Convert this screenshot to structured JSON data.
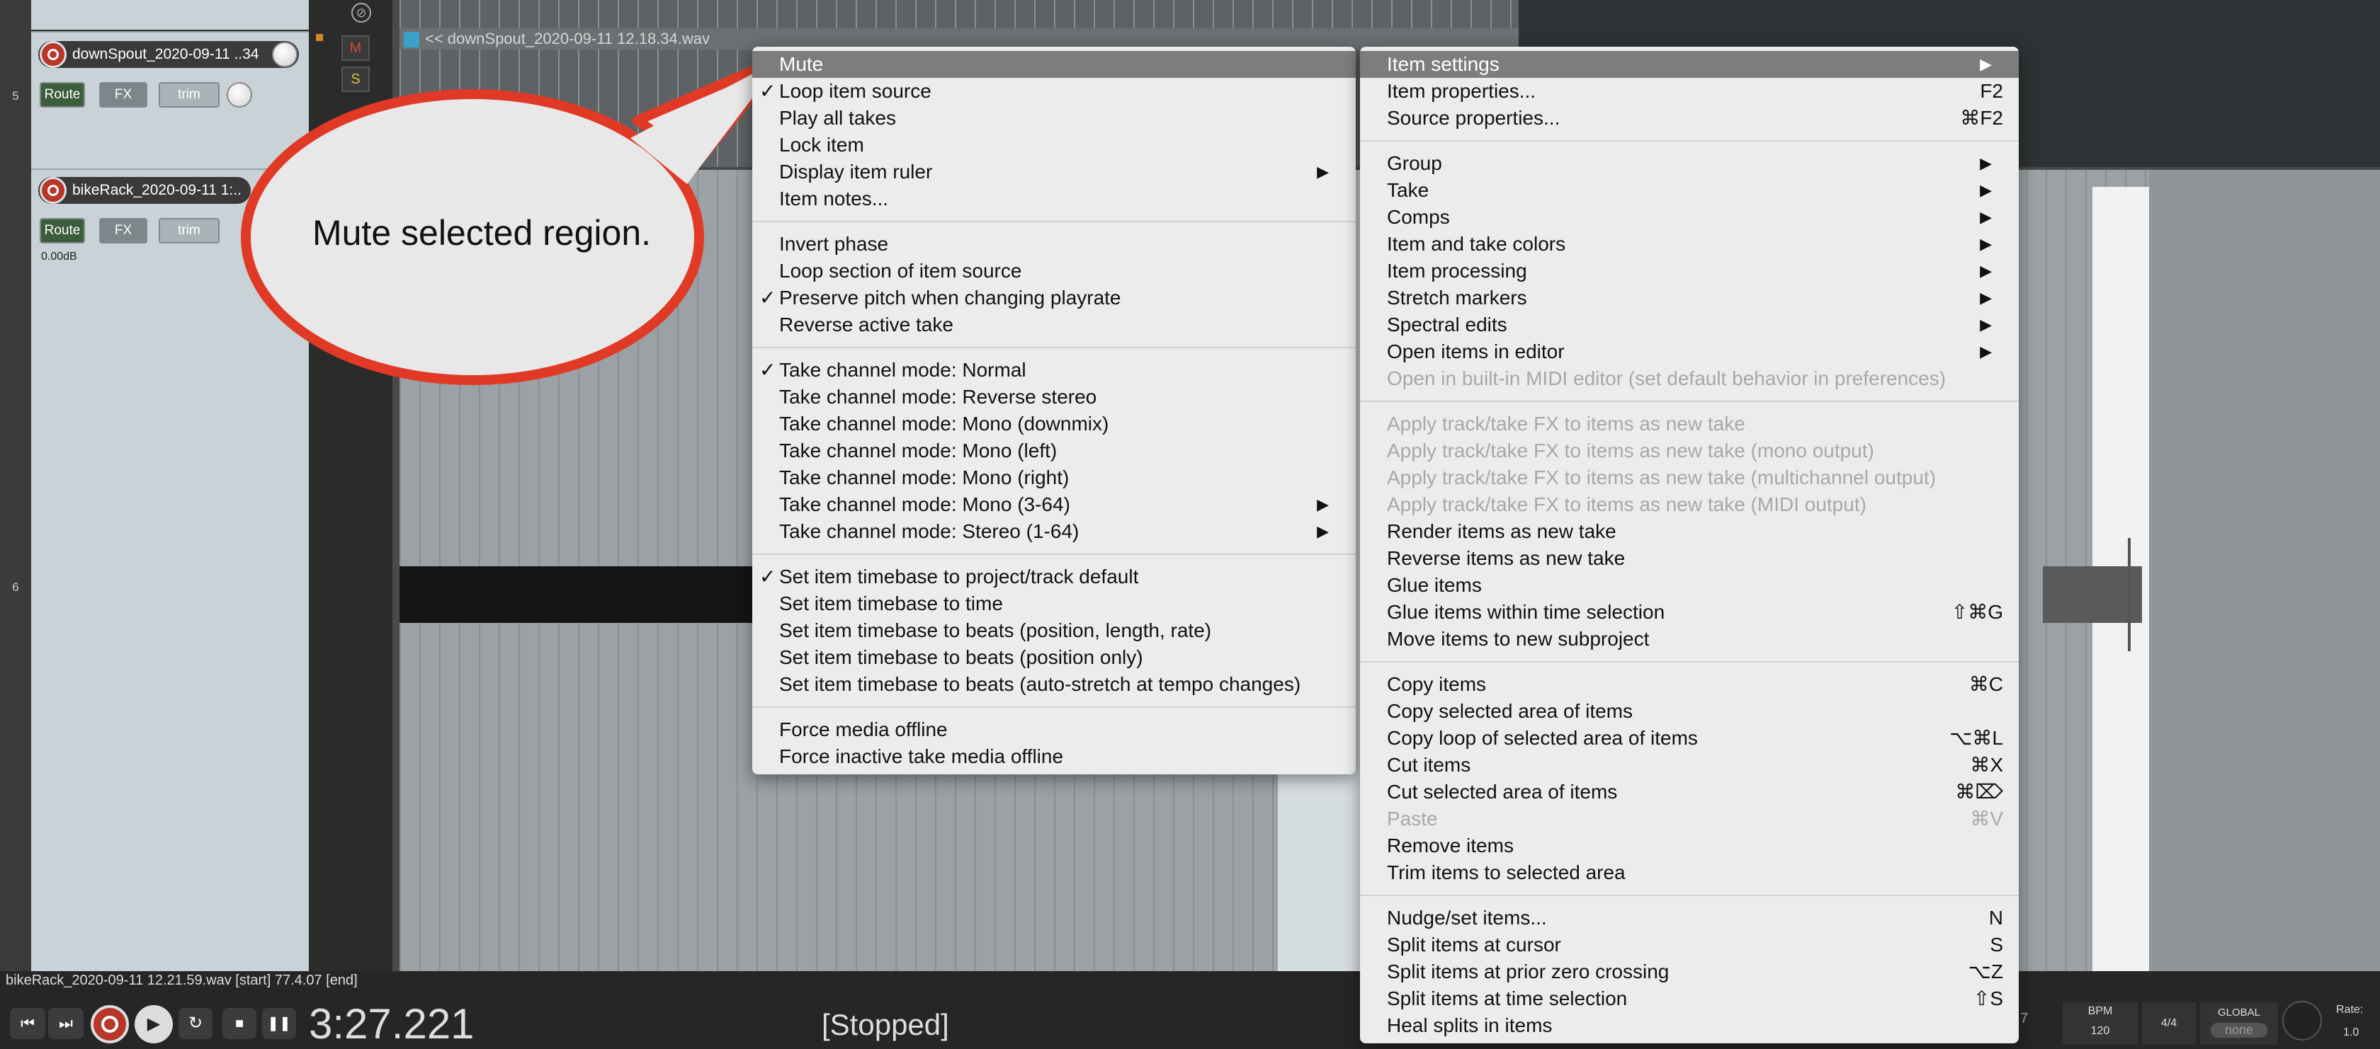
{
  "tracks": [
    {
      "number": "5",
      "name": "downSpout_2020-09-11 ..34"
    },
    {
      "number": "6",
      "name": "bikeRack_2020-09-11 1:..",
      "volume": "0.00dB"
    }
  ],
  "track_buttons": {
    "route": "Route",
    "fx": "FX",
    "trim": "trim",
    "mute": "M",
    "solo": "S"
  },
  "item_label": "<< downSpout_2020-09-11 12.18.34.wav",
  "status_text": "bikeRack_2020-09-11 12.21.59.wav [start] 77.4.07 [end]",
  "transport": {
    "time": "3:27.221",
    "state": "[Stopped]",
    "bpm_label": "BPM",
    "bpm": "120",
    "timesig": "4/4",
    "global_label": "GLOBAL",
    "global_value": "none",
    "rate_label": "Rate:",
    "rate": "1.0",
    "partial_digit": "7"
  },
  "callout": "Mute selected region.",
  "menu_left": [
    {
      "type": "item",
      "label": "Mute",
      "highlighted": true
    },
    {
      "type": "item",
      "label": "Loop item source",
      "checked": true
    },
    {
      "type": "item",
      "label": "Play all takes"
    },
    {
      "type": "item",
      "label": "Lock item"
    },
    {
      "type": "item",
      "label": "Display item ruler",
      "submenu": true
    },
    {
      "type": "item",
      "label": "Item notes..."
    },
    {
      "type": "sep"
    },
    {
      "type": "item",
      "label": "Invert phase"
    },
    {
      "type": "item",
      "label": "Loop section of item source"
    },
    {
      "type": "item",
      "label": "Preserve pitch when changing playrate",
      "checked": true
    },
    {
      "type": "item",
      "label": "Reverse active take"
    },
    {
      "type": "sep"
    },
    {
      "type": "item",
      "label": "Take channel mode: Normal",
      "checked": true
    },
    {
      "type": "item",
      "label": "Take channel mode: Reverse stereo"
    },
    {
      "type": "item",
      "label": "Take channel mode: Mono (downmix)"
    },
    {
      "type": "item",
      "label": "Take channel mode: Mono (left)"
    },
    {
      "type": "item",
      "label": "Take channel mode: Mono (right)"
    },
    {
      "type": "item",
      "label": "Take channel mode: Mono (3-64)",
      "submenu": true
    },
    {
      "type": "item",
      "label": "Take channel mode: Stereo (1-64)",
      "submenu": true
    },
    {
      "type": "sep"
    },
    {
      "type": "item",
      "label": "Set item timebase to project/track default",
      "checked": true
    },
    {
      "type": "item",
      "label": "Set item timebase to time"
    },
    {
      "type": "item",
      "label": "Set item timebase to beats (position, length, rate)"
    },
    {
      "type": "item",
      "label": "Set item timebase to beats (position only)"
    },
    {
      "type": "item",
      "label": "Set item timebase to beats (auto-stretch at tempo changes)"
    },
    {
      "type": "sep"
    },
    {
      "type": "item",
      "label": "Force media offline"
    },
    {
      "type": "item",
      "label": "Force inactive take media offline"
    }
  ],
  "menu_right": [
    {
      "type": "item",
      "label": "Item settings",
      "highlighted": true,
      "submenu": true
    },
    {
      "type": "item",
      "label": "Item properties...",
      "shortcut": "F2"
    },
    {
      "type": "item",
      "label": "Source properties...",
      "shortcut": "⌘F2"
    },
    {
      "type": "sep"
    },
    {
      "type": "item",
      "label": "Group",
      "submenu": true
    },
    {
      "type": "item",
      "label": "Take",
      "submenu": true
    },
    {
      "type": "item",
      "label": "Comps",
      "submenu": true
    },
    {
      "type": "item",
      "label": "Item and take colors",
      "submenu": true
    },
    {
      "type": "item",
      "label": "Item processing",
      "submenu": true
    },
    {
      "type": "item",
      "label": "Stretch markers",
      "submenu": true
    },
    {
      "type": "item",
      "label": "Spectral edits",
      "submenu": true
    },
    {
      "type": "item",
      "label": "Open items in editor",
      "submenu": true
    },
    {
      "type": "item",
      "label": "Open in built-in MIDI editor (set default behavior in preferences)",
      "disabled": true
    },
    {
      "type": "sep"
    },
    {
      "type": "item",
      "label": "Apply track/take FX to items as new take",
      "disabled": true
    },
    {
      "type": "item",
      "label": "Apply track/take FX to items as new take (mono output)",
      "disabled": true
    },
    {
      "type": "item",
      "label": "Apply track/take FX to items as new take (multichannel output)",
      "disabled": true
    },
    {
      "type": "item",
      "label": "Apply track/take FX to items as new take (MIDI output)",
      "disabled": true
    },
    {
      "type": "item",
      "label": "Render items as new take"
    },
    {
      "type": "item",
      "label": "Reverse items as new take"
    },
    {
      "type": "item",
      "label": "Glue items"
    },
    {
      "type": "item",
      "label": "Glue items within time selection",
      "shortcut": "⇧⌘G"
    },
    {
      "type": "item",
      "label": "Move items to new subproject"
    },
    {
      "type": "sep"
    },
    {
      "type": "item",
      "label": "Copy items",
      "shortcut": "⌘C"
    },
    {
      "type": "item",
      "label": "Copy selected area of items"
    },
    {
      "type": "item",
      "label": "Copy loop of selected area of items",
      "shortcut": "⌥⌘L"
    },
    {
      "type": "item",
      "label": "Cut items",
      "shortcut": "⌘X"
    },
    {
      "type": "item",
      "label": "Cut selected area of items",
      "shortcut": "⌘⌦"
    },
    {
      "type": "item",
      "label": "Paste",
      "shortcut": "⌘V",
      "disabled": true
    },
    {
      "type": "item",
      "label": "Remove items"
    },
    {
      "type": "item",
      "label": "Trim items to selected area"
    },
    {
      "type": "sep"
    },
    {
      "type": "item",
      "label": "Nudge/set items...",
      "shortcut": "N"
    },
    {
      "type": "item",
      "label": "Split items at cursor",
      "shortcut": "S"
    },
    {
      "type": "item",
      "label": "Split items at prior zero crossing",
      "shortcut": "⌥Z"
    },
    {
      "type": "item",
      "label": "Split items at time selection",
      "shortcut": "⇧S"
    },
    {
      "type": "item",
      "label": "Heal splits in items"
    }
  ]
}
